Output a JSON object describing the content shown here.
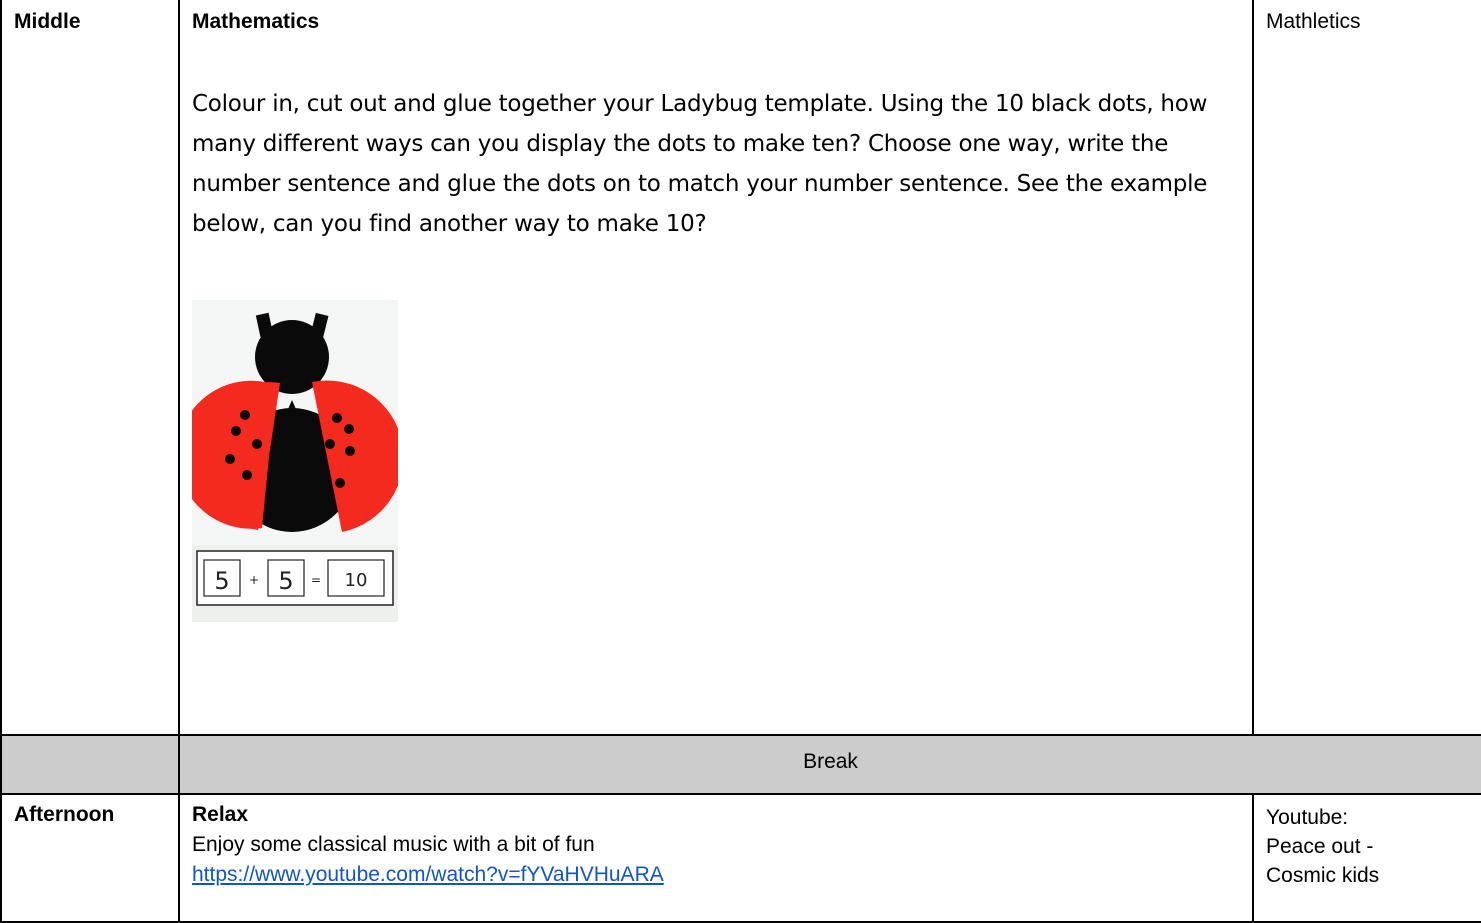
{
  "rows": {
    "middle": {
      "slot": "Middle",
      "subject": "Mathematics",
      "instructions": "Colour in, cut out and glue together your Ladybug template. Using the 10 black dots, how many different ways can you display the dots to make ten? Choose one way, write the number sentence and glue the dots on to match your number sentence. See the example below, can you find another way to make 10?",
      "equation": [
        "5",
        "+",
        "5",
        "=",
        "10"
      ],
      "resource": "Mathletics"
    },
    "break": {
      "label": "Break"
    },
    "afternoon": {
      "slot": "Afternoon",
      "subject": "Relax",
      "description": "Enjoy some classical music with a bit of fun",
      "link": "https://www.youtube.com/watch?v=fYVaHVHuARA",
      "resource_line1": "Youtube:",
      "resource_line2": "Peace out -",
      "resource_line3": "Cosmic kids"
    }
  },
  "colors": {
    "break_row_bg": "#cccccc",
    "link": "#1155cc",
    "ladybug_red": "#f42a1e",
    "ladybug_black": "#0a0a0a"
  }
}
